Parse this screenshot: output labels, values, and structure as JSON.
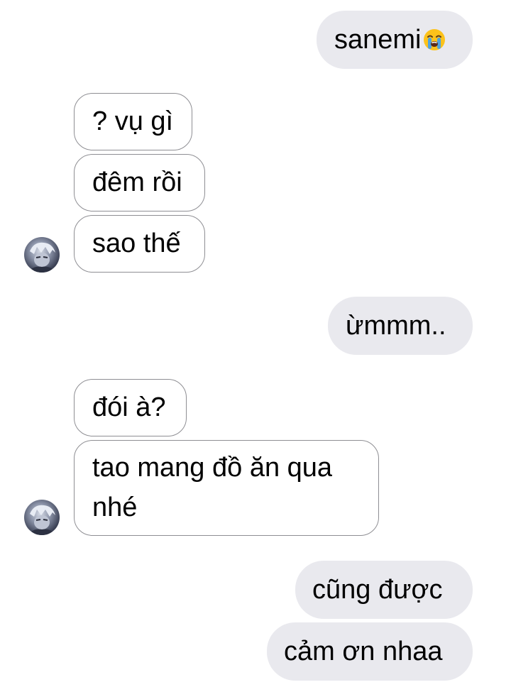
{
  "chat": {
    "contact_avatar_icon": "contact-avatar",
    "messages": [
      {
        "side": "out",
        "text": "sanemi",
        "emoji": "loudly-crying-face"
      },
      {
        "side": "in",
        "text": "? vụ gì"
      },
      {
        "side": "in",
        "text": "đêm rồi"
      },
      {
        "side": "in",
        "text": "sao thế"
      },
      {
        "side": "out",
        "text": "ừmmm.."
      },
      {
        "side": "in",
        "text": "đói à?"
      },
      {
        "side": "in",
        "text": "tao mang đồ ăn qua",
        "text2": "nhé"
      },
      {
        "side": "out",
        "text": "cũng được"
      },
      {
        "side": "out",
        "text": "cảm ơn nhaa"
      }
    ]
  },
  "colors": {
    "outgoing_bubble": "#e9e9ee",
    "incoming_bubble": "#ffffff",
    "incoming_border": "#8e8e93",
    "text": "#000000"
  }
}
